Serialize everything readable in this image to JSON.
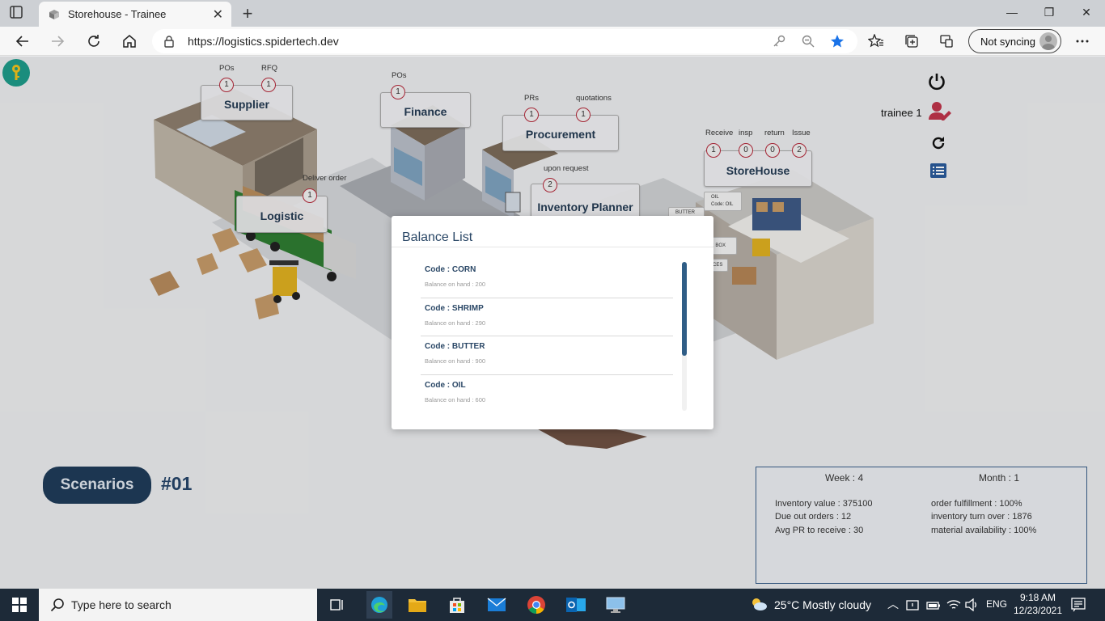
{
  "browser": {
    "tab_title": "Storehouse - Trainee",
    "url": "https://logistics.spidertech.dev",
    "sync_label": "Not syncing"
  },
  "app": {
    "user_name": "trainee 1",
    "stations": {
      "supplier": {
        "name": "Supplier",
        "counters": [
          {
            "label": "POs",
            "value": "1"
          },
          {
            "label": "RFQ",
            "value": "1"
          }
        ]
      },
      "finance": {
        "name": "Finance",
        "counters": [
          {
            "label": "POs",
            "value": "1"
          }
        ]
      },
      "procurement": {
        "name": "Procurement",
        "counters": [
          {
            "label": "PRs",
            "value": "1"
          },
          {
            "label": "quotations",
            "value": "1"
          }
        ]
      },
      "inventory_planner": {
        "name": "Inventory Planner",
        "counters": [
          {
            "label": "upon request",
            "value": "2"
          }
        ]
      },
      "logistic": {
        "name": "Logistic",
        "counters": [
          {
            "label": "Deliver order",
            "value": "1"
          }
        ]
      },
      "storehouse": {
        "name": "StoreHouse",
        "counters": [
          {
            "label": "Receive",
            "value": "1"
          },
          {
            "label": "insp",
            "value": "0"
          },
          {
            "label": "return",
            "value": "0"
          },
          {
            "label": "Issue",
            "value": "2"
          }
        ]
      }
    },
    "shelf_tags": {
      "oil_title": "OIL",
      "oil_code": "Code: OIL",
      "butter": "BUTTER",
      "box_fragment": ": BOX",
      "ces_fragment": "CES"
    },
    "scenario": {
      "button_label": "Scenarios",
      "number": "#01"
    },
    "stats": {
      "week": "Week : 4",
      "month": "Month : 1",
      "left": [
        "Inventory value : 375100",
        "Due out orders : 12",
        "Avg PR to receive : 30"
      ],
      "right": [
        "order fulfillment : 100%",
        "inventory turn over : 1876",
        "material availability : 100%"
      ]
    }
  },
  "modal": {
    "title": "Balance List",
    "items": [
      {
        "code": "Code : CORN",
        "balance": "Balance on hand : 200"
      },
      {
        "code": "Code : SHRIMP",
        "balance": "Balance on hand : 290"
      },
      {
        "code": "Code : BUTTER",
        "balance": "Balance on hand : 900"
      },
      {
        "code": "Code : OIL",
        "balance": "Balance on hand : 600"
      }
    ]
  },
  "taskbar": {
    "search_placeholder": "Type here to search",
    "weather": "25°C  Mostly cloudy",
    "language": "ENG",
    "time": "9:18 AM",
    "date": "12/23/2021"
  },
  "colors": {
    "accent": "#2a4766",
    "chip_border": "#b5283a",
    "key_badge": "#1e9b8a"
  }
}
